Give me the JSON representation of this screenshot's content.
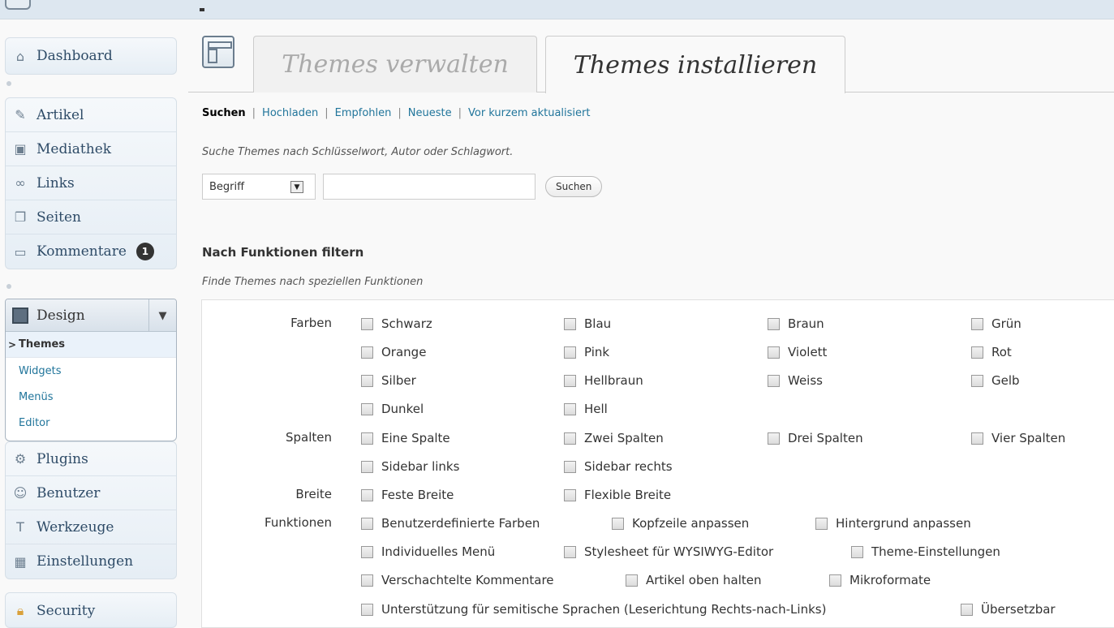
{
  "sidebar": {
    "dashboard": "Dashboard",
    "items": [
      {
        "label": "Artikel",
        "icon": "pin-icon"
      },
      {
        "label": "Mediathek",
        "icon": "media-icon"
      },
      {
        "label": "Links",
        "icon": "link-icon"
      },
      {
        "label": "Seiten",
        "icon": "pages-icon"
      },
      {
        "label": "Kommentare",
        "icon": "comment-icon",
        "badge": "1"
      }
    ],
    "design": {
      "label": "Design",
      "submenu": [
        "Themes",
        "Widgets",
        "Menüs",
        "Editor"
      ]
    },
    "items2": [
      {
        "label": "Plugins",
        "icon": "plugin-icon"
      },
      {
        "label": "Benutzer",
        "icon": "users-icon"
      },
      {
        "label": "Werkzeuge",
        "icon": "tools-icon"
      },
      {
        "label": "Einstellungen",
        "icon": "settings-icon"
      }
    ],
    "security": "Security"
  },
  "tabs": {
    "manage": "Themes verwalten",
    "install": "Themes installieren"
  },
  "subnav": [
    "Suchen",
    "Hochladen",
    "Empfohlen",
    "Neueste",
    "Vor kurzem aktualisiert"
  ],
  "search": {
    "hint": "Suche Themes nach Schlüsselwort, Autor oder Schlagwort.",
    "select_value": "Begriff",
    "input_value": "",
    "button": "Suchen"
  },
  "filter": {
    "title": "Nach Funktionen filtern",
    "hint": "Finde Themes nach speziellen Funktionen",
    "groups": {
      "farben": {
        "label": "Farben",
        "options": [
          "Schwarz",
          "Blau",
          "Braun",
          "Grün",
          "Orange",
          "Pink",
          "Violett",
          "Rot",
          "Silber",
          "Hellbraun",
          "Weiss",
          "Gelb",
          "Dunkel",
          "Hell"
        ]
      },
      "spalten": {
        "label": "Spalten",
        "options": [
          "Eine Spalte",
          "Zwei Spalten",
          "Drei Spalten",
          "Vier Spalten",
          "Sidebar links",
          "Sidebar rechts"
        ]
      },
      "breite": {
        "label": "Breite",
        "options": [
          "Feste Breite",
          "Flexible Breite"
        ]
      },
      "funktionen": {
        "label": "Funktionen",
        "options": [
          "Benutzerdefinierte Farben",
          "Kopfzeile anpassen",
          "Hintergrund anpassen",
          "Individuelles Menü",
          "Stylesheet für WYSIWYG-Editor",
          "Theme-Einstellungen",
          "Verschachtelte Kommentare",
          "Artikel oben halten",
          "Mikroformate",
          "Unterstützung für semitische Sprachen (Leserichtung Rechts-nach-Links)",
          "Übersetzbar"
        ]
      }
    }
  }
}
